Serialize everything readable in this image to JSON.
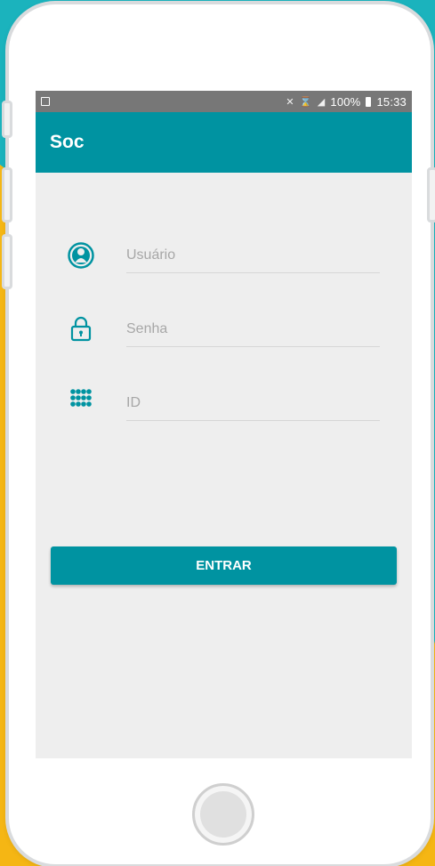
{
  "statusbar": {
    "left_icon": "gallery-icon",
    "signal_icons": "mute-icon wifi-icon signal-icon",
    "battery": "100%",
    "battery_icon": "battery-icon",
    "time": "15:33"
  },
  "app": {
    "title": "Soc"
  },
  "form": {
    "usuario": {
      "icon": "user-icon",
      "placeholder": "Usuário"
    },
    "senha": {
      "icon": "lock-icon",
      "placeholder": "Senha"
    },
    "id": {
      "icon": "keypad-icon",
      "placeholder": "ID"
    },
    "submit_label": "ENTRAR"
  },
  "colors": {
    "primary": "#0093a1",
    "background_teal": "#1bb3bd",
    "background_yellow": "#f5b614",
    "screen_bg": "#eeeeee",
    "statusbar": "#777777"
  }
}
